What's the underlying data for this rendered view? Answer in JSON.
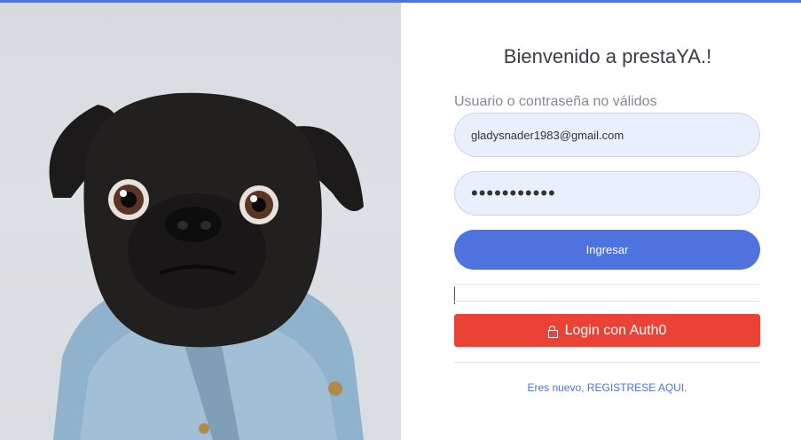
{
  "photo": {
    "alt_subject": "pug-in-denim-jacket"
  },
  "form": {
    "title": "Bienvenido a prestaYA.!",
    "error_message": "Usuario o contraseña no válidos",
    "email_value": "gladysnader1983@gmail.com",
    "password_value": "•••••••••••",
    "login_button_label": "Ingresar",
    "auth0_button_label": "Login con Auth0",
    "register_link_label": "Eres nuevo, REGISTRESE AQUI."
  },
  "colors": {
    "primary": "#4e73df",
    "danger": "#ea4335",
    "input_bg": "#e8f0fe",
    "muted_text": "#858796"
  },
  "icons": {
    "auth0_button": "lock-icon"
  }
}
